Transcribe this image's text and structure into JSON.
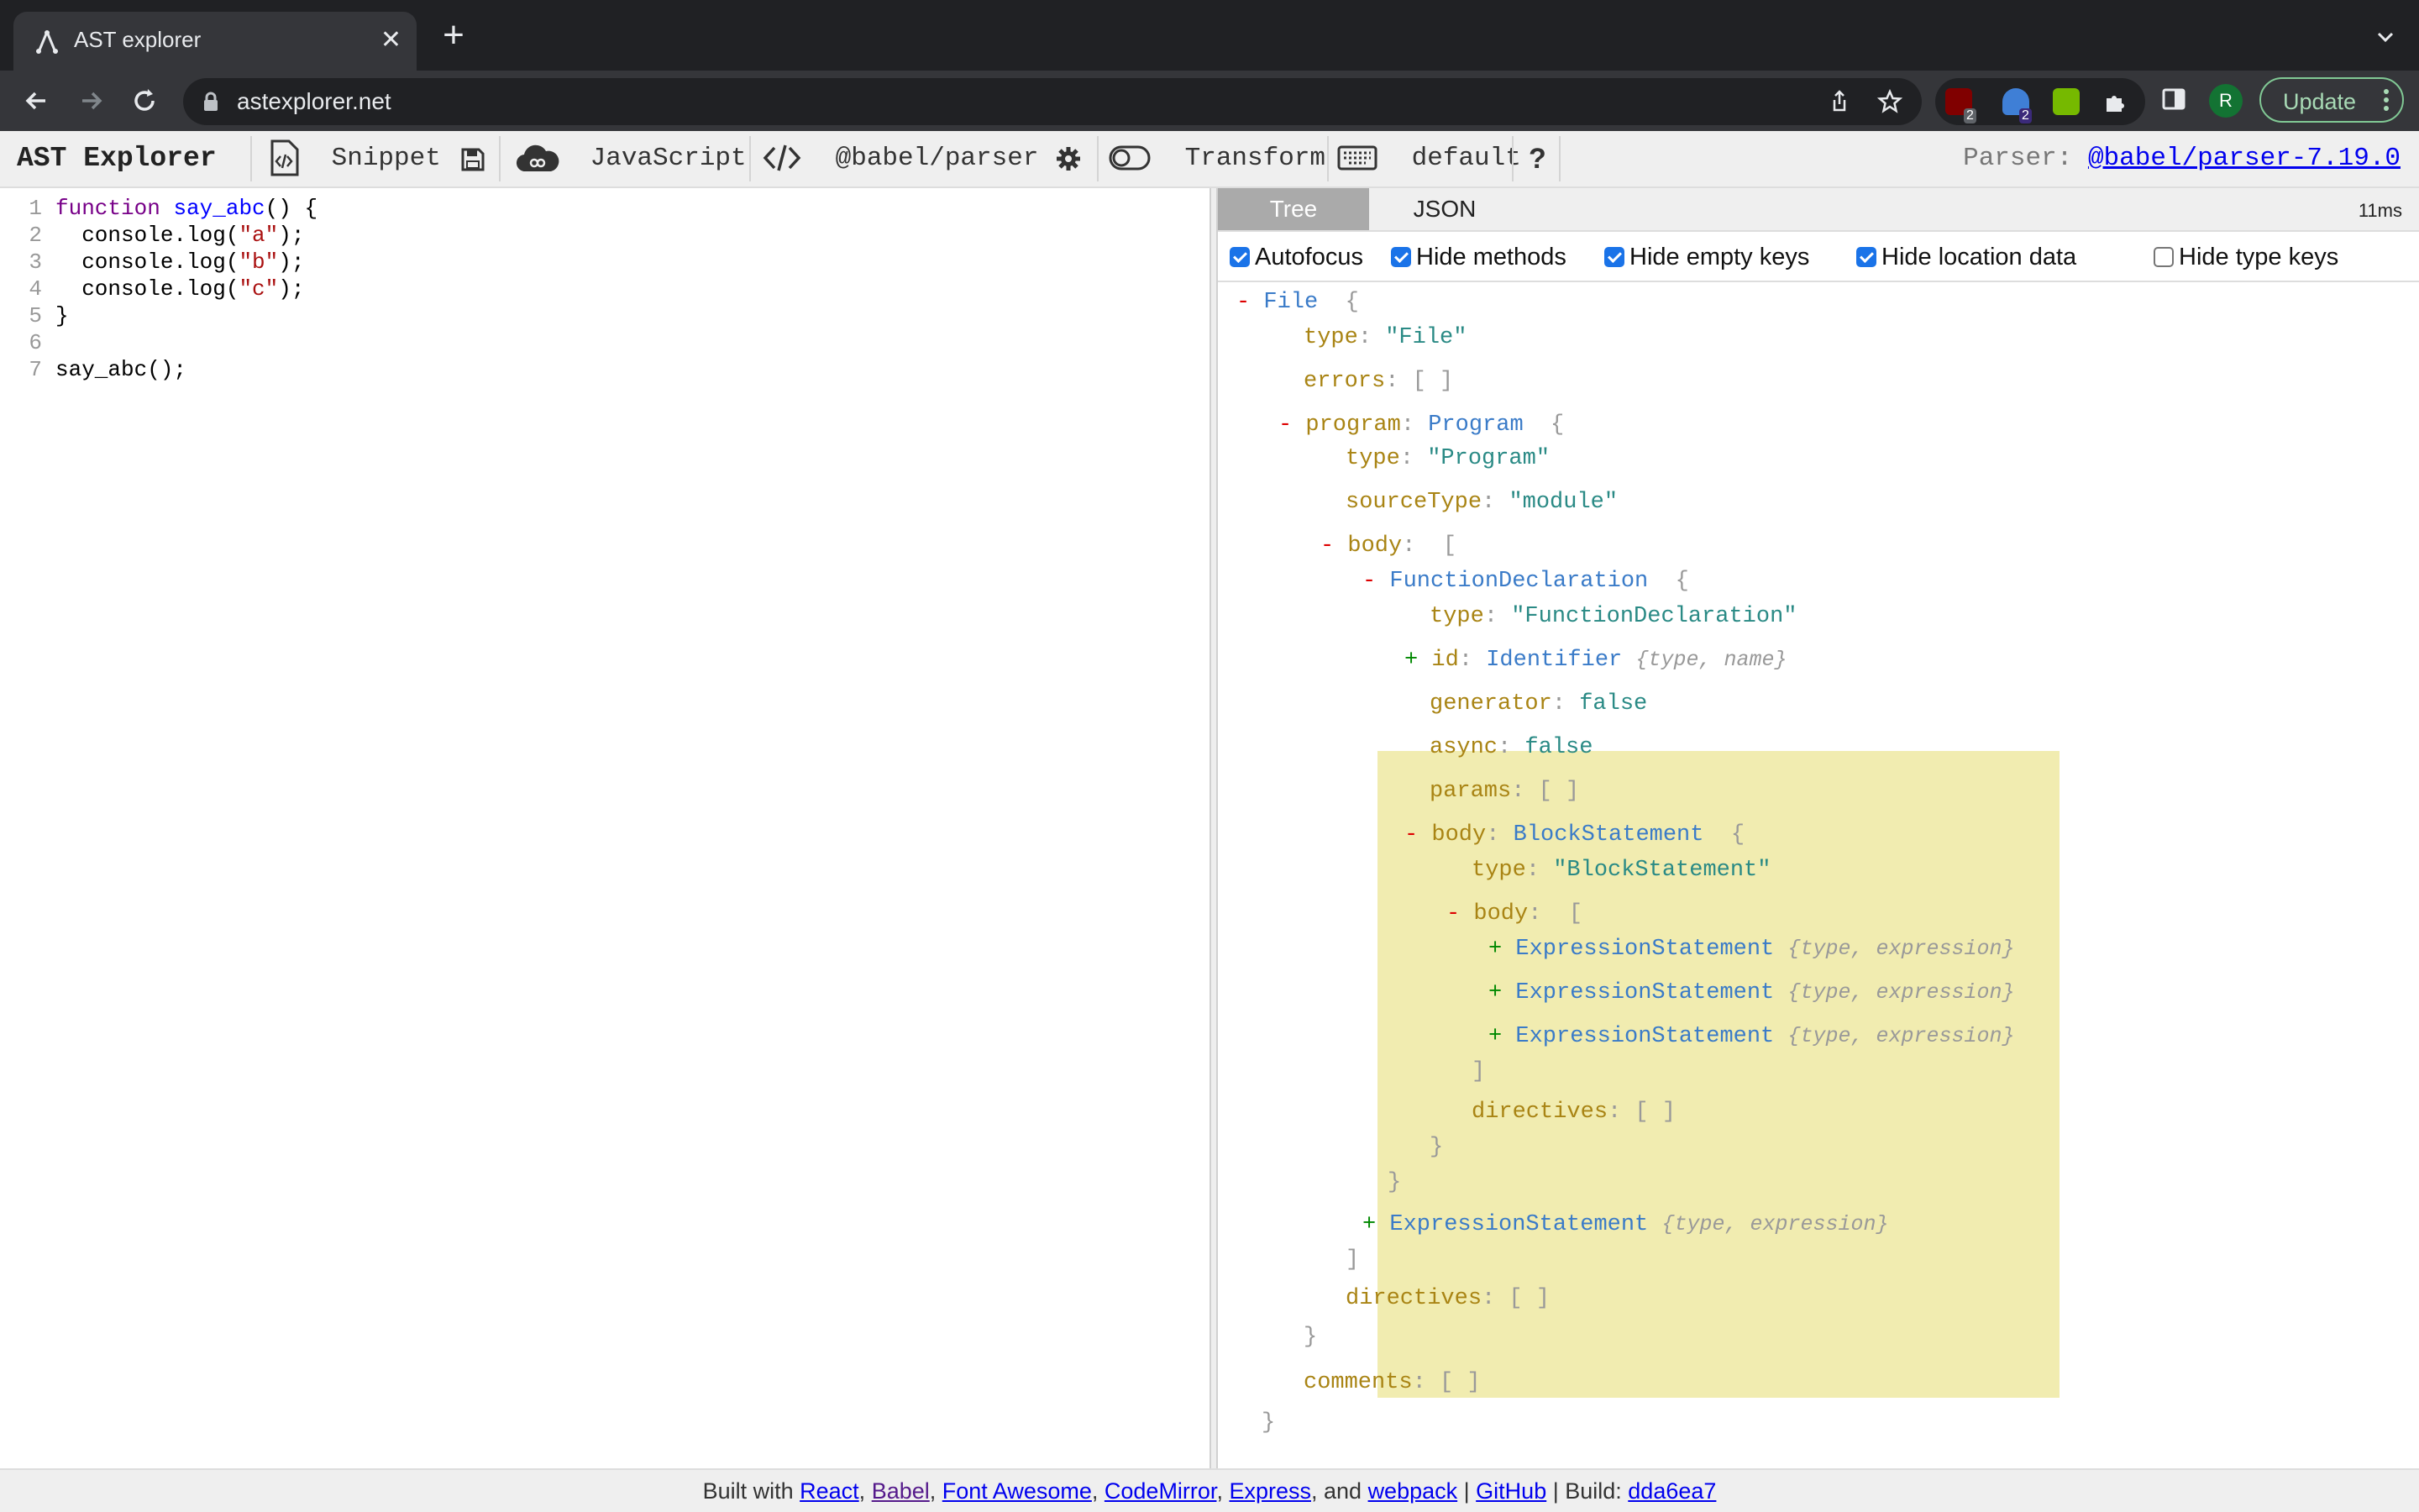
{
  "browser": {
    "tab_title": "AST explorer",
    "url": "astexplorer.net",
    "update_label": "Update",
    "avatar_letter": "R",
    "extensions": [
      {
        "icon": "ublock-icon",
        "badge": "2"
      },
      {
        "icon": "ghostery-icon",
        "badge": "2"
      },
      {
        "icon": "nvidia-icon",
        "badge": ""
      }
    ]
  },
  "app_toolbar": {
    "brand": "AST Explorer",
    "snippet": "Snippet",
    "language": "JavaScript",
    "parser": "@babel/parser",
    "transform": "Transform",
    "keymap": "default",
    "help": "?",
    "parser_label": "Parser:",
    "parser_version": "@babel/parser-7.19.0"
  },
  "editor": {
    "lines": [
      {
        "n": "1",
        "parts": [
          [
            "kw",
            "function"
          ],
          [
            "t",
            " "
          ],
          [
            "def",
            "say_abc"
          ],
          [
            "t",
            "() {"
          ]
        ]
      },
      {
        "n": "2",
        "parts": [
          [
            "t",
            "  console.log("
          ],
          [
            "str",
            "\"a\""
          ],
          [
            "t",
            ");"
          ]
        ]
      },
      {
        "n": "3",
        "parts": [
          [
            "t",
            "  console.log("
          ],
          [
            "str",
            "\"b\""
          ],
          [
            "t",
            ");"
          ]
        ]
      },
      {
        "n": "4",
        "parts": [
          [
            "t",
            "  console.log("
          ],
          [
            "str",
            "\"c\""
          ],
          [
            "t",
            ");"
          ]
        ]
      },
      {
        "n": "5",
        "parts": [
          [
            "t",
            "}"
          ]
        ]
      },
      {
        "n": "6",
        "parts": []
      },
      {
        "n": "7",
        "parts": [
          [
            "t",
            "say_abc();"
          ]
        ]
      }
    ]
  },
  "output": {
    "tabs": [
      "Tree",
      "JSON"
    ],
    "active_tab": "Tree",
    "time": "11ms",
    "options": [
      {
        "label": "Autofocus",
        "checked": true
      },
      {
        "label": "Hide methods",
        "checked": true
      },
      {
        "label": "Hide empty keys",
        "checked": true
      },
      {
        "label": "Hide location data",
        "checked": true
      },
      {
        "label": "Hide type keys",
        "checked": false
      }
    ],
    "tree": [
      {
        "d": 0,
        "tog": "-",
        "parts": [
          [
            "typ",
            "File"
          ],
          [
            "punc",
            "  {"
          ]
        ]
      },
      {
        "d": 1,
        "parts": [
          [
            "key",
            "type"
          ],
          [
            "punc",
            ": "
          ],
          [
            "sval",
            "\"File\""
          ]
        ]
      },
      {
        "d": 1,
        "parts": [
          [
            "key",
            "errors"
          ],
          [
            "punc",
            ": [ ]"
          ]
        ]
      },
      {
        "d": 1,
        "tog": "-",
        "parts": [
          [
            "key",
            "program"
          ],
          [
            "punc",
            ": "
          ],
          [
            "typ",
            "Program"
          ],
          [
            "punc",
            "  {"
          ]
        ]
      },
      {
        "d": 2,
        "parts": [
          [
            "key",
            "type"
          ],
          [
            "punc",
            ": "
          ],
          [
            "sval",
            "\"Program\""
          ]
        ]
      },
      {
        "d": 2,
        "parts": [
          [
            "key",
            "sourceType"
          ],
          [
            "punc",
            ": "
          ],
          [
            "sval",
            "\"module\""
          ]
        ]
      },
      {
        "d": 2,
        "tog": "-",
        "parts": [
          [
            "key",
            "body"
          ],
          [
            "punc",
            ":  ["
          ]
        ]
      },
      {
        "d": 3,
        "tog": "-",
        "parts": [
          [
            "typ",
            "FunctionDeclaration"
          ],
          [
            "punc",
            "  {"
          ]
        ]
      },
      {
        "d": 4,
        "parts": [
          [
            "key",
            "type"
          ],
          [
            "punc",
            ": "
          ],
          [
            "sval",
            "\"FunctionDeclaration\""
          ]
        ]
      },
      {
        "d": 4,
        "tog": "+",
        "parts": [
          [
            "key",
            "id"
          ],
          [
            "punc",
            ": "
          ],
          [
            "typ",
            "Identifier"
          ],
          [
            "punc",
            " "
          ],
          [
            "summary",
            "{type, name}"
          ]
        ]
      },
      {
        "d": 4,
        "parts": [
          [
            "key",
            "generator"
          ],
          [
            "punc",
            ": "
          ],
          [
            "bval",
            "false"
          ]
        ]
      },
      {
        "d": 4,
        "parts": [
          [
            "key",
            "async"
          ],
          [
            "punc",
            ": "
          ],
          [
            "bval",
            "false"
          ]
        ]
      },
      {
        "d": 4,
        "parts": [
          [
            "key",
            "params"
          ],
          [
            "punc",
            ": [ ]"
          ]
        ]
      },
      {
        "d": 4,
        "tog": "-",
        "parts": [
          [
            "key",
            "body"
          ],
          [
            "punc",
            ": "
          ],
          [
            "typ",
            "BlockStatement"
          ],
          [
            "punc",
            "  {"
          ]
        ]
      },
      {
        "d": 5,
        "parts": [
          [
            "key",
            "type"
          ],
          [
            "punc",
            ": "
          ],
          [
            "sval",
            "\"BlockStatement\""
          ]
        ]
      },
      {
        "d": 5,
        "tog": "-",
        "parts": [
          [
            "key",
            "body"
          ],
          [
            "punc",
            ":  ["
          ]
        ]
      },
      {
        "d": 6,
        "tog": "+",
        "parts": [
          [
            "typ",
            "ExpressionStatement"
          ],
          [
            "punc",
            " "
          ],
          [
            "summary",
            "{type, expression}"
          ]
        ]
      },
      {
        "d": 6,
        "tog": "+",
        "parts": [
          [
            "typ",
            "ExpressionStatement"
          ],
          [
            "punc",
            " "
          ],
          [
            "summary",
            "{type, expression}"
          ]
        ]
      },
      {
        "d": 6,
        "tog": "+",
        "parts": [
          [
            "typ",
            "ExpressionStatement"
          ],
          [
            "punc",
            " "
          ],
          [
            "summary",
            "{type, expression}"
          ]
        ]
      },
      {
        "d": 5,
        "parts": [
          [
            "punc",
            "]"
          ]
        ]
      },
      {
        "d": 5,
        "parts": [
          [
            "key",
            "directives"
          ],
          [
            "punc",
            ": [ ]"
          ]
        ]
      },
      {
        "d": 4,
        "parts": [
          [
            "punc",
            "}"
          ]
        ]
      },
      {
        "d": 3,
        "parts": [
          [
            "punc",
            "}"
          ]
        ]
      },
      {
        "d": 3,
        "tog": "+",
        "parts": [
          [
            "typ",
            "ExpressionStatement"
          ],
          [
            "punc",
            " "
          ],
          [
            "summary",
            "{type, expression}"
          ]
        ]
      },
      {
        "d": 2,
        "parts": [
          [
            "punc",
            "]"
          ]
        ]
      },
      {
        "d": 2,
        "parts": [
          [
            "key",
            "directives"
          ],
          [
            "punc",
            ": [ ]"
          ]
        ]
      },
      {
        "d": 1,
        "parts": [
          [
            "punc",
            "}"
          ]
        ]
      },
      {
        "d": 1,
        "parts": [
          [
            "key",
            "comments"
          ],
          [
            "punc",
            ": [ ]"
          ]
        ]
      },
      {
        "d": 0,
        "parts": [
          [
            "punc",
            "}"
          ]
        ]
      }
    ]
  },
  "footer": {
    "prefix": "Built with ",
    "links": [
      "React",
      "Babel",
      "Font Awesome",
      "CodeMirror",
      "Express"
    ],
    "and": ", and ",
    "webpack": "webpack",
    "sep": " | ",
    "github": "GitHub",
    "build_label": " | Build: ",
    "build": "dda6ea7"
  }
}
